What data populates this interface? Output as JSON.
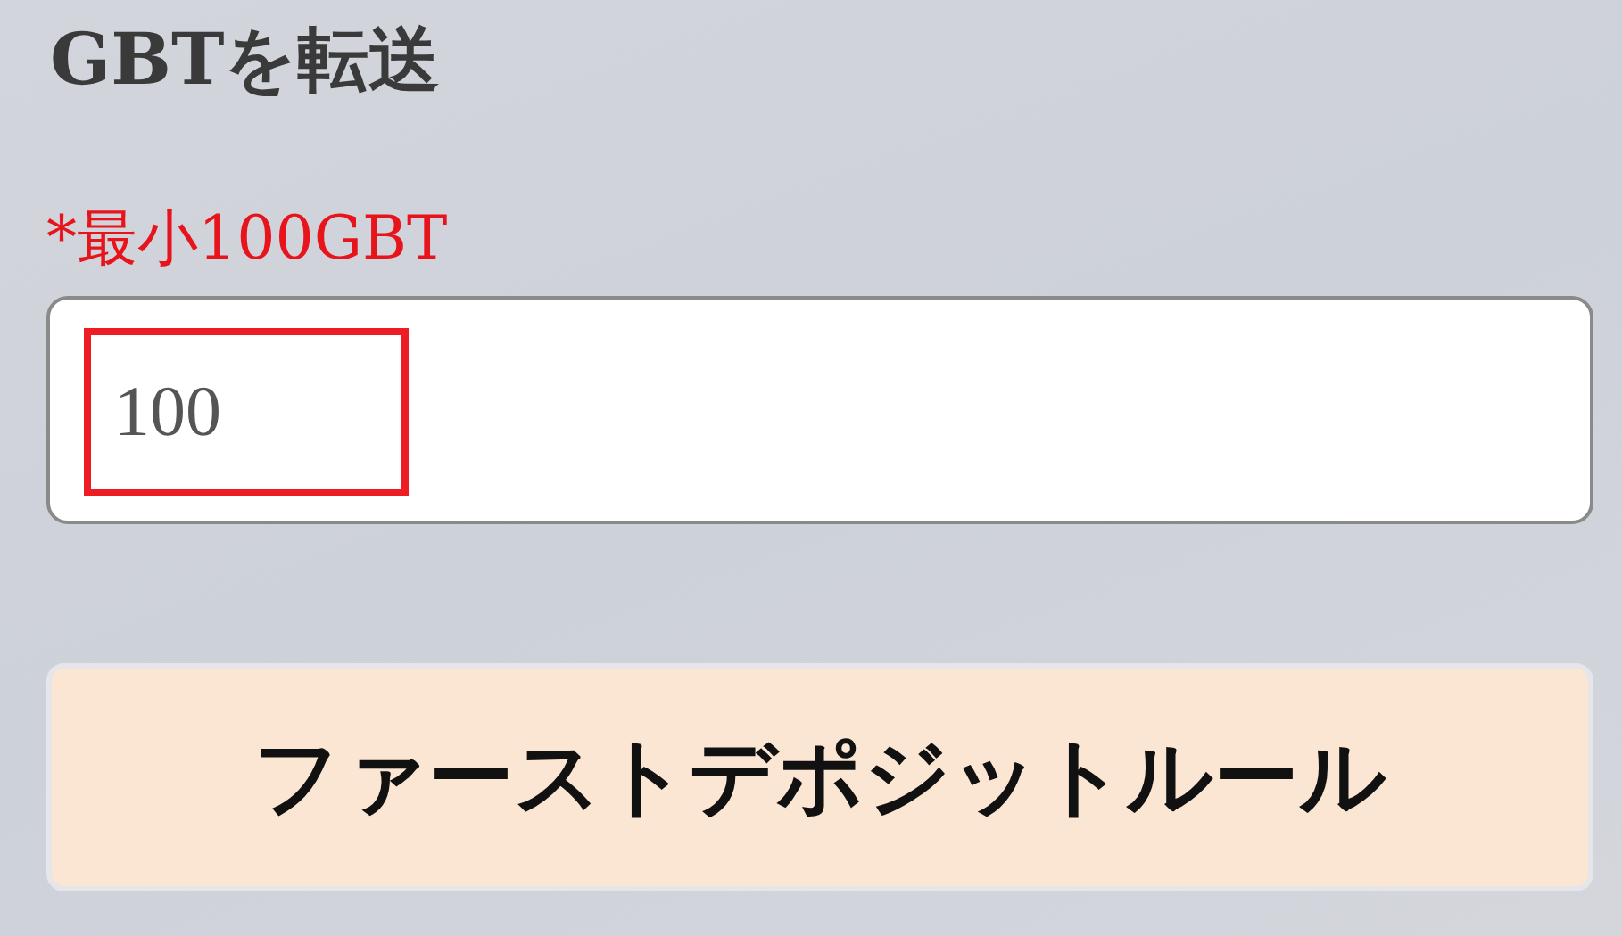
{
  "title": "GBTを転送",
  "amount": {
    "label": "*最小100GBT",
    "placeholder": "100",
    "highlighted": true
  },
  "button": {
    "label": "ファーストデポジットルール"
  }
}
